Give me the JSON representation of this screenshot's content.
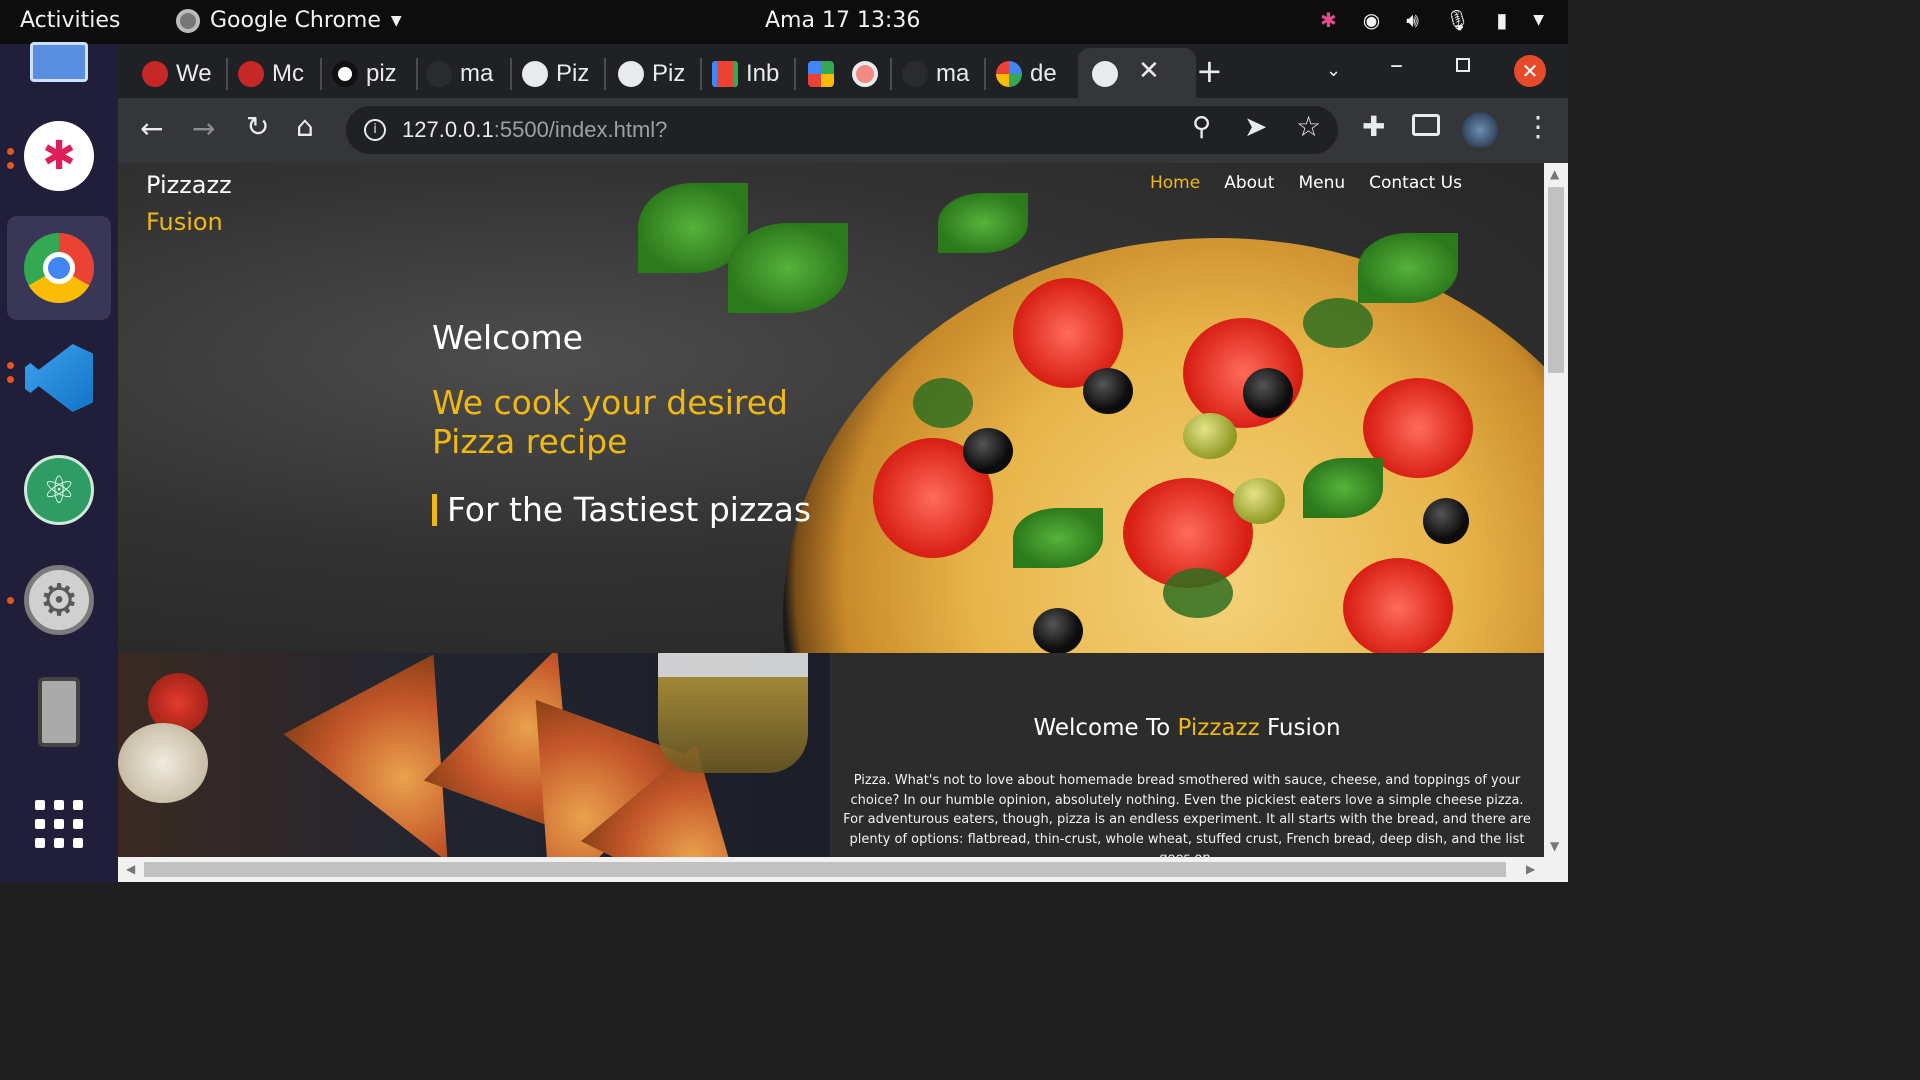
{
  "system": {
    "activities": "Activities",
    "app_name": "Google Chrome",
    "clock": "Ama 17  13:36"
  },
  "tabs": [
    {
      "title": "We",
      "icon": "asterisk-red-icon"
    },
    {
      "title": "Mc",
      "icon": "asterisk-red-icon"
    },
    {
      "title": "piz",
      "icon": "spiral-icon"
    },
    {
      "title": "ma",
      "icon": "github-icon"
    },
    {
      "title": "Piz",
      "icon": "globe-icon"
    },
    {
      "title": "Piz",
      "icon": "globe-icon"
    },
    {
      "title": "Inb",
      "icon": "gmail-icon"
    },
    {
      "title": "",
      "icon": "meet-icon"
    },
    {
      "title": "",
      "icon": "record-icon"
    },
    {
      "title": "ma",
      "icon": "github-icon"
    },
    {
      "title": "de",
      "icon": "google-icon"
    }
  ],
  "address_bar": {
    "host": "127.0.0.1",
    "path": ":5500/index.html?"
  },
  "site": {
    "brand_line1": "Pizzazz",
    "brand_line2": "Fusion",
    "nav": [
      "Home",
      "About",
      "Menu",
      "Contact Us"
    ],
    "welcome": "Welcome",
    "tagline": "We cook your desired Pizza recipe",
    "typed_text": "For the Tastiest pizzas",
    "about_title_pre": "Welcome To ",
    "about_title_brand": "Pizzazz",
    "about_title_post": " Fusion",
    "about_text": "Pizza. What's not to love about homemade bread smothered with sauce, cheese, and toppings of your choice? In our humble opinion, absolutely nothing. Even the pickiest eaters love a simple cheese pizza. For adventurous eaters, though, pizza is an endless experiment. It all starts with the bread, and there are plenty of options: flatbread, thin-crust, whole wheat, stuffed crust, French bread, deep dish, and the list goes on."
  },
  "colors": {
    "accent": "#f0b810",
    "page_bg": "#2c2c2c"
  }
}
